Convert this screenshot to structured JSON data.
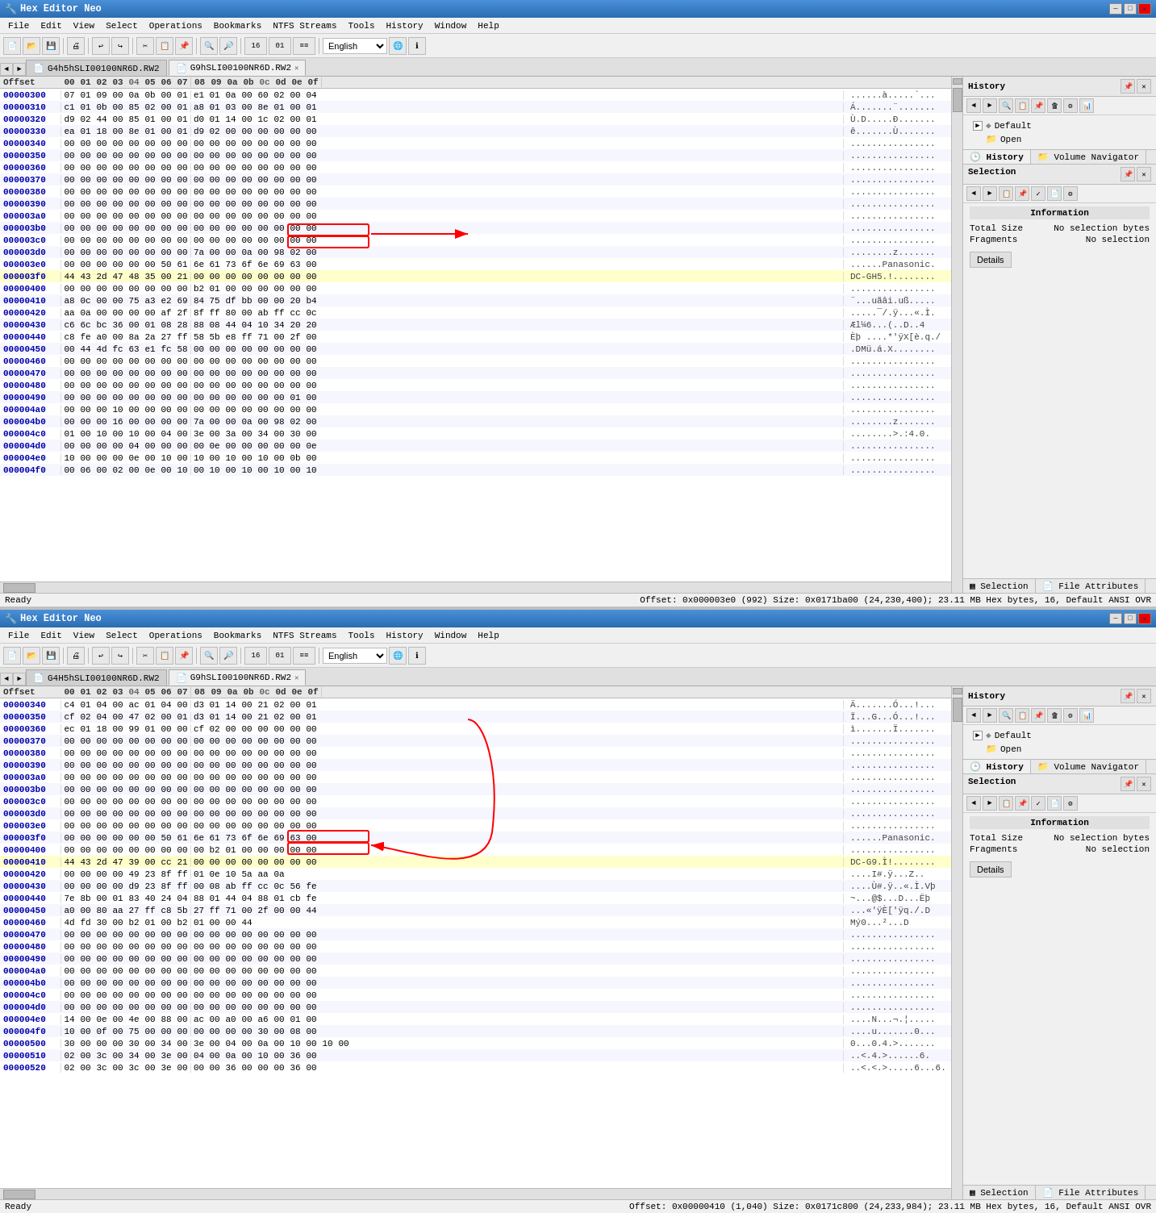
{
  "windows": [
    {
      "title": "Hex Editor Neo",
      "menus": [
        "File",
        "Edit",
        "View",
        "Select",
        "Operations",
        "Bookmarks",
        "NTFS Streams",
        "Tools",
        "History",
        "Window",
        "Help"
      ],
      "language": "English",
      "tabs": [
        {
          "label": "G4h5hSLI00100NR6D.RW2",
          "active": false,
          "closeable": false
        },
        {
          "label": "G9hSLI00100NR6D.RW2",
          "active": true,
          "closeable": true
        }
      ],
      "status": "Ready",
      "statusRight": "Offset: 0x000003e0 (992)  Size: 0x0171ba00 (24,230,400); 23.11 MB  Hex bytes, 16, Default ANSI  OVR",
      "hexHeader": [
        "00",
        "01",
        "02",
        "03",
        "04",
        "05",
        "06",
        "07",
        "08",
        "09",
        "0a",
        "0b",
        "0c",
        "0d",
        "0e",
        "0f"
      ],
      "rows": [
        {
          "addr": "00000300",
          "bytes": "07 01 09 00 0a 0b 00 01 e1 01 0a 00 60 02 00 04",
          "ascii": "......à.....`..."
        },
        {
          "addr": "00000310",
          "bytes": "c1 01 0b 00 85 02 00 01 a8 01 03 00 8e 01 00 01",
          "ascii": "Á.......¨......."
        },
        {
          "addr": "00000320",
          "bytes": "d9 02 44 00 85 01 00 01 d0 01 14 00 1c 02 00 01",
          "ascii": "Ù.D.....Ð......."
        },
        {
          "addr": "00000330",
          "bytes": "ea 01 18 00 8e 01 00 01 d9 02 00 00 00 00 00 00",
          "ascii": "ê.......Ù......."
        },
        {
          "addr": "00000340",
          "bytes": "00 00 00 00 00 00 00 00 00 00 00 00 00 00 00 00",
          "ascii": "................"
        },
        {
          "addr": "00000350",
          "bytes": "00 00 00 00 00 00 00 00 00 00 00 00 00 00 00 00",
          "ascii": "................"
        },
        {
          "addr": "00000360",
          "bytes": "00 00 00 00 00 00 00 00 00 00 00 00 00 00 00 00",
          "ascii": "................"
        },
        {
          "addr": "00000370",
          "bytes": "00 00 00 00 00 00 00 00 00 00 00 00 00 00 00 00",
          "ascii": "................"
        },
        {
          "addr": "00000380",
          "bytes": "00 00 00 00 00 00 00 00 00 00 00 00 00 00 00 00",
          "ascii": "................"
        },
        {
          "addr": "00000390",
          "bytes": "00 00 00 00 00 00 00 00 00 00 00 00 00 00 00 00",
          "ascii": "................"
        },
        {
          "addr": "000003a0",
          "bytes": "00 00 00 00 00 00 00 00 00 00 00 00 00 00 00 00",
          "ascii": "................"
        },
        {
          "addr": "000003b0",
          "bytes": "00 00 00 00 00 00 00 00 00 00 00 00 00 00 00 00",
          "ascii": "................"
        },
        {
          "addr": "000003c0",
          "bytes": "00 00 00 00 00 00 00 00 00 00 00 00 00 00 00 00",
          "ascii": "................"
        },
        {
          "addr": "000003d0",
          "bytes": "00 00 00 00 00 00 00 00 7a 00 00 0a 00 98 02 00",
          "ascii": "........z......."
        },
        {
          "addr": "000003e0",
          "bytes": "00 00 00 00 00 00 50 61 6e 61 73 6f 6e 69 63 00",
          "ascii": "......Panasonic."
        },
        {
          "addr": "000003f0",
          "bytes": "44 43 2d 47 48 35 00 21 00 00 00 00 00 00 00 00",
          "ascii": "DC-GH5.!........",
          "highlighted": true
        },
        {
          "addr": "00000400",
          "bytes": "00 00 00 00 00 00 00 00 b2 01 00 00 00 00 00 00",
          "ascii": "................"
        },
        {
          "addr": "00000410",
          "bytes": "a8 0c 00 00 75 a3 e2 69 84 75 df bb 00 00 20 b4",
          "ascii": "¨...uãâi.uß....."
        },
        {
          "addr": "00000420",
          "bytes": "aa 0a 00 00 00 00 af 2f 8f ff 80 00 ab ff cc 0c",
          "ascii": ".....¯/.ÿ...«.Ì."
        },
        {
          "addr": "00000430",
          "bytes": "c6 6c bc 36 00 01 08 28 88 08 44 04 10 34 20 20",
          "ascii": "Æl¼6...(..D..4  "
        },
        {
          "addr": "00000440",
          "bytes": "c8 fe a0 00 8a 2a 27 ff 58 5b e8 ff 71 00 2f 00",
          "ascii": "Èþ ....*'ÿX[è.q./"
        },
        {
          "addr": "00000450",
          "bytes": "00 44 4d fc 63 e1 fc 58 00 00 00 00 00 00 00 00",
          "ascii": ".DMü.á.X........"
        },
        {
          "addr": "00000460",
          "bytes": "00 00 00 00 00 00 00 00 00 00 00 00 00 00 00 00",
          "ascii": "................"
        },
        {
          "addr": "00000470",
          "bytes": "00 00 00 00 00 00 00 00 00 00 00 00 00 00 00 00",
          "ascii": "................"
        },
        {
          "addr": "00000480",
          "bytes": "00 00 00 00 00 00 00 00 00 00 00 00 00 00 00 00",
          "ascii": "................"
        },
        {
          "addr": "00000490",
          "bytes": "00 00 00 00 00 00 00 00 00 00 00 00 00 00 01 00",
          "ascii": "................"
        },
        {
          "addr": "000004a0",
          "bytes": "00 00 00 10 00 00 00 00 00 00 00 00 00 00 00 00",
          "ascii": "................"
        },
        {
          "addr": "000004b0",
          "bytes": "00 00 00 16 00 00 00 00 7a 00 00 0a 00 98 02 00",
          "ascii": "........z......."
        },
        {
          "addr": "000004c0",
          "bytes": "01 00 10 00 10 00 04 00 3e 00 3a 00 34 00 30 00",
          "ascii": "........>.:4.0. "
        },
        {
          "addr": "000004d0",
          "bytes": "00 00 00 00 04 00 00 00 00 0e 00 00 00 00 00 0e",
          "ascii": "................"
        },
        {
          "addr": "000004e0",
          "bytes": "10 00 00 00 0e 00 10 00 10 00 10 00 10 00 0b 00",
          "ascii": "................"
        },
        {
          "addr": "000004f0",
          "bytes": "00 06 00 02 00 0e 00 10 00 10 00 10 00 10 00 10",
          "ascii": "................"
        }
      ],
      "history": {
        "title": "History",
        "default_label": "Default",
        "open_label": "Open"
      },
      "selection": {
        "title": "Selection",
        "info_title": "Information",
        "total_size_label": "Total Size",
        "total_size_value": "No selection",
        "total_size_unit": "bytes",
        "fragments_label": "Fragments",
        "fragments_value": "No selection",
        "details_btn": "Details"
      }
    },
    {
      "title": "Hex Editor Neo",
      "menus": [
        "File",
        "Edit",
        "View",
        "Select",
        "Operations",
        "Bookmarks",
        "NTFS Streams",
        "Tools",
        "History",
        "Window",
        "Help"
      ],
      "language": "English",
      "tabs": [
        {
          "label": "G4H5hSLI00100NR6D.RW2",
          "active": false,
          "closeable": false
        },
        {
          "label": "G9hSLI00100NR6D.RW2",
          "active": true,
          "closeable": true
        }
      ],
      "status": "Ready",
      "statusRight": "Offset: 0x00000410 (1,040)  Size: 0x0171c800 (24,233,984); 23.11 MB  Hex bytes, 16, Default ANSI  OVR",
      "hexHeader": [
        "00",
        "01",
        "02",
        "03",
        "04",
        "05",
        "06",
        "07",
        "08",
        "09",
        "0a",
        "0b",
        "0c",
        "0d",
        "0e",
        "0f"
      ],
      "rows": [
        {
          "addr": "00000340",
          "bytes": "c4 01 04 00 ac 01 04 00 d3 01 14 00 21 02 00 01",
          "ascii": "Ä.......Ó...!..."
        },
        {
          "addr": "00000350",
          "bytes": "cf 02 04 00 47 02 00 01 d3 01 14 00 21 02 00 01",
          "ascii": "Ï...G...Ó...!..."
        },
        {
          "addr": "00000360",
          "bytes": "ec 01 18 00 99 01 00 00 cf 02 00 00 00 00 00 00",
          "ascii": "ì.......Ï......."
        },
        {
          "addr": "00000370",
          "bytes": "00 00 00 00 00 00 00 00 00 00 00 00 00 00 00 00",
          "ascii": "................"
        },
        {
          "addr": "00000380",
          "bytes": "00 00 00 00 00 00 00 00 00 00 00 00 00 00 00 00",
          "ascii": "................"
        },
        {
          "addr": "00000390",
          "bytes": "00 00 00 00 00 00 00 00 00 00 00 00 00 00 00 00",
          "ascii": "................"
        },
        {
          "addr": "000003a0",
          "bytes": "00 00 00 00 00 00 00 00 00 00 00 00 00 00 00 00",
          "ascii": "................"
        },
        {
          "addr": "000003b0",
          "bytes": "00 00 00 00 00 00 00 00 00 00 00 00 00 00 00 00",
          "ascii": "................"
        },
        {
          "addr": "000003c0",
          "bytes": "00 00 00 00 00 00 00 00 00 00 00 00 00 00 00 00",
          "ascii": "................"
        },
        {
          "addr": "000003d0",
          "bytes": "00 00 00 00 00 00 00 00 00 00 00 00 00 00 00 00",
          "ascii": "................"
        },
        {
          "addr": "000003e0",
          "bytes": "00 00 00 00 00 00 00 00 00 00 00 00 00 00 00 00",
          "ascii": "................"
        },
        {
          "addr": "000003f0",
          "bytes": "00 00 00 00 00 00 50 61 6e 61 73 6f 6e 69 63 00",
          "ascii": "......Panasonic."
        },
        {
          "addr": "00000400",
          "bytes": "00 00 00 00 00 00 00 00 00 b2 01 00 00 00 00 00",
          "ascii": "................"
        },
        {
          "addr": "00000410",
          "bytes": "44 43 2d 47 39 00 cc 21 00 00 00 00 00 00 00 00",
          "ascii": "DC-G9.Ì!........",
          "highlighted": true
        },
        {
          "addr": "00000420",
          "bytes": "00 00 00 00 49 23 8f ff 01 0e 10 5a aa 0a",
          "ascii": "....I#.ÿ...Z.."
        },
        {
          "addr": "00000430",
          "bytes": "00 00 00 00 d9 23 8f ff 00 08 ab ff cc 0c 56 fe",
          "ascii": "....Ù#.ÿ..«.Ì.Vþ"
        },
        {
          "addr": "00000440",
          "bytes": "7e 8b 00 01 83 40 24 04 88 01 44 04 88 01 cb fe",
          "ascii": "~...@$...D...Ëþ"
        },
        {
          "addr": "00000450",
          "bytes": "a0 00 80 aa 27 ff c8 5b 27 ff 71 00 2f 00 00 44",
          "ascii": "...«'ÿÈ['ÿq./.D"
        },
        {
          "addr": "00000460",
          "bytes": "4d fd 30 00 b2 01 00 b2 01 00 00 44",
          "ascii": "Mý0...²...D"
        },
        {
          "addr": "00000470",
          "bytes": "00 00 00 00 00 00 00 00 00 00 00 00 00 00 00 00",
          "ascii": "................"
        },
        {
          "addr": "00000480",
          "bytes": "00 00 00 00 00 00 00 00 00 00 00 00 00 00 00 00",
          "ascii": "................"
        },
        {
          "addr": "00000490",
          "bytes": "00 00 00 00 00 00 00 00 00 00 00 00 00 00 00 00",
          "ascii": "................"
        },
        {
          "addr": "000004a0",
          "bytes": "00 00 00 00 00 00 00 00 00 00 00 00 00 00 00 00",
          "ascii": "................"
        },
        {
          "addr": "000004b0",
          "bytes": "00 00 00 00 00 00 00 00 00 00 00 00 00 00 00 00",
          "ascii": "................"
        },
        {
          "addr": "000004c0",
          "bytes": "00 00 00 00 00 00 00 00 00 00 00 00 00 00 00 00",
          "ascii": "................"
        },
        {
          "addr": "000004d0",
          "bytes": "00 00 00 00 00 00 00 00 00 00 00 00 00 00 00 00",
          "ascii": "................"
        },
        {
          "addr": "000004e0",
          "bytes": "14 00 0e 00 4e 00 88 00 ac 00 a0 00 a6 00 01 00",
          "ascii": "....N...¬.¦....."
        },
        {
          "addr": "000004f0",
          "bytes": "10 00 0f 00 75 00 00 00 00 00 00 00 30 00 08 00",
          "ascii": "....u.......0..."
        },
        {
          "addr": "00000500",
          "bytes": "30 00 00 00 30 00 34 00 3e 00 04 00 0a 00 10 00 10 00",
          "ascii": "0...0.4.>......."
        },
        {
          "addr": "00000510",
          "bytes": "02 00 3c 00 34 00 3e 00 04 00 0a 00 10 00 36 00",
          "ascii": "..<.4.>......6."
        },
        {
          "addr": "00000520",
          "bytes": "02 00 3c 00 3c 00 3e 00 00 00 36 00 00 00 36 00",
          "ascii": "..<.<.>.....6...6."
        }
      ],
      "history": {
        "title": "History",
        "default_label": "Default",
        "open_label": "Open"
      },
      "selection": {
        "title": "Selection",
        "info_title": "Information",
        "total_size_label": "Total Size",
        "total_size_value": "No selection",
        "total_size_unit": "bytes",
        "fragments_label": "Fragments",
        "fragments_value": "No selection",
        "details_btn": "Details"
      }
    }
  ],
  "icons": {
    "minimize": "─",
    "maximize": "□",
    "close": "✕",
    "history": "🕒",
    "volume": "📁",
    "selection": "▦",
    "tree_expand": "+",
    "tree_collapse": "─",
    "pin": "📌",
    "nav_prev": "◄",
    "nav_next": "►",
    "file_icon": "📄"
  }
}
